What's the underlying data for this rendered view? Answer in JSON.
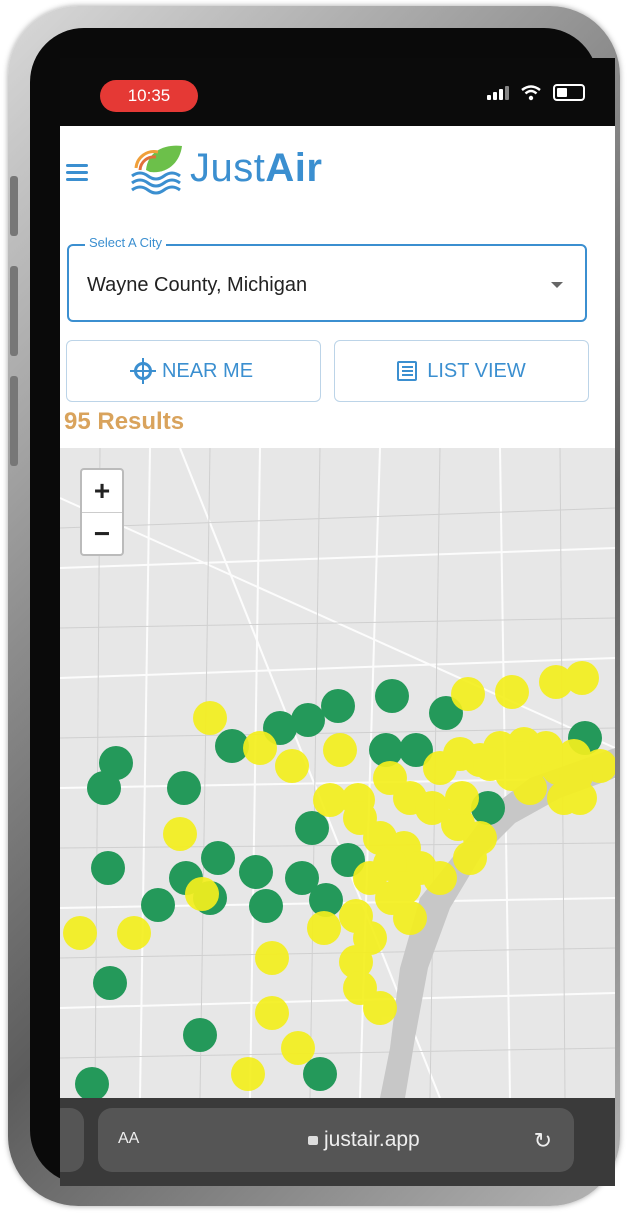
{
  "status": {
    "time": "10:35",
    "wifi_icon": "wifi-icon",
    "battery_icon": "battery-icon"
  },
  "header": {
    "logo_part1": "Just",
    "logo_part2": "Air"
  },
  "city_select": {
    "legend": "Select A City",
    "value": "Wayne County, Michigan"
  },
  "buttons": {
    "near_me": "NEAR ME",
    "list_view": "LIST VIEW"
  },
  "results_label": "95 Results",
  "map": {
    "zoom_in": "+",
    "zoom_out": "−",
    "colors": {
      "good": "#24995a",
      "moderate": "#f4ef1e"
    }
  },
  "browser": {
    "aa": "AA",
    "url": "justair.app",
    "reload": "↻"
  }
}
